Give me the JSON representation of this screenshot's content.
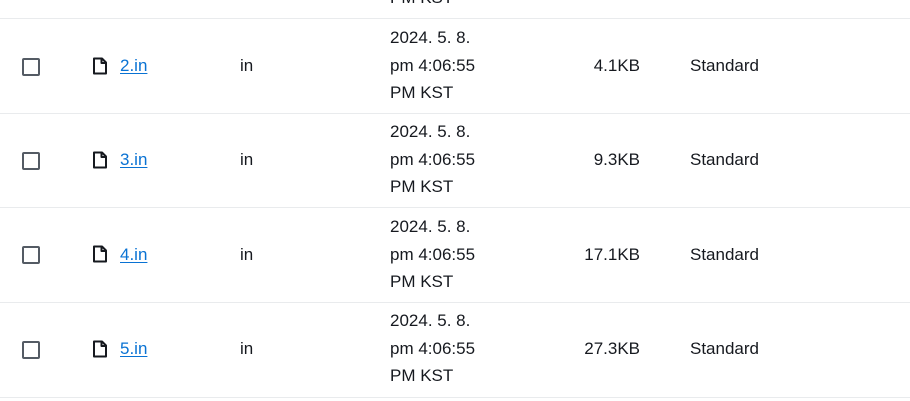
{
  "top_fragment": "PM KST",
  "rows": [
    {
      "name": "2.in",
      "type": "in",
      "date_line1": "2024. 5. 8.",
      "date_line2": "pm 4:06:55",
      "date_line3": "PM KST",
      "size": "4.1KB",
      "storage_class": "Standard"
    },
    {
      "name": "3.in",
      "type": "in",
      "date_line1": "2024. 5. 8.",
      "date_line2": "pm 4:06:55",
      "date_line3": "PM KST",
      "size": "9.3KB",
      "storage_class": "Standard"
    },
    {
      "name": "4.in",
      "type": "in",
      "date_line1": "2024. 5. 8.",
      "date_line2": "pm 4:06:55",
      "date_line3": "PM KST",
      "size": "17.1KB",
      "storage_class": "Standard"
    },
    {
      "name": "5.in",
      "type": "in",
      "date_line1": "2024. 5. 8.",
      "date_line2": "pm 4:06:55",
      "date_line3": "PM KST",
      "size": "27.3KB",
      "storage_class": "Standard"
    }
  ],
  "icons": {
    "file": "file-icon"
  }
}
